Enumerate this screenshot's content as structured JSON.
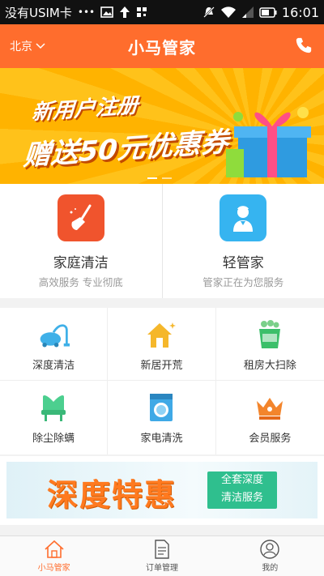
{
  "status_bar": {
    "carrier": "没有USIM卡",
    "dots": "•••",
    "time": "16:01"
  },
  "header": {
    "city": "北京",
    "title": "小马管家"
  },
  "banner": {
    "line1": "新用户注册",
    "line2": "赠送50元优惠券"
  },
  "services": [
    {
      "name": "家庭清洁",
      "sub": "高效服务 专业彻底",
      "icon": "broom-icon",
      "color": "#f0542d"
    },
    {
      "name": "轻管家",
      "sub": "管家正在为您服务",
      "icon": "butler-icon",
      "color": "#36b4f0"
    }
  ],
  "grid": [
    {
      "label": "深度清洁",
      "icon": "vacuum-icon"
    },
    {
      "label": "新居开荒",
      "icon": "house-icon"
    },
    {
      "label": "租房大扫除",
      "icon": "bucket-icon"
    },
    {
      "label": "除尘除螨",
      "icon": "chair-icon"
    },
    {
      "label": "家电清洗",
      "icon": "washer-icon"
    },
    {
      "label": "会员服务",
      "icon": "crown-icon"
    }
  ],
  "promo": {
    "big": "深度特惠",
    "box_line1": "全套深度",
    "box_line2": "清洁服务"
  },
  "tabs": [
    {
      "label": "小马管家",
      "icon": "home-icon",
      "active": true
    },
    {
      "label": "订单管理",
      "icon": "document-icon",
      "active": false
    },
    {
      "label": "我的",
      "icon": "user-icon",
      "active": false
    }
  ],
  "colors": {
    "brand": "#ff6d2d",
    "accent_blue": "#36b4f0",
    "accent_green": "#2fbf8e"
  }
}
